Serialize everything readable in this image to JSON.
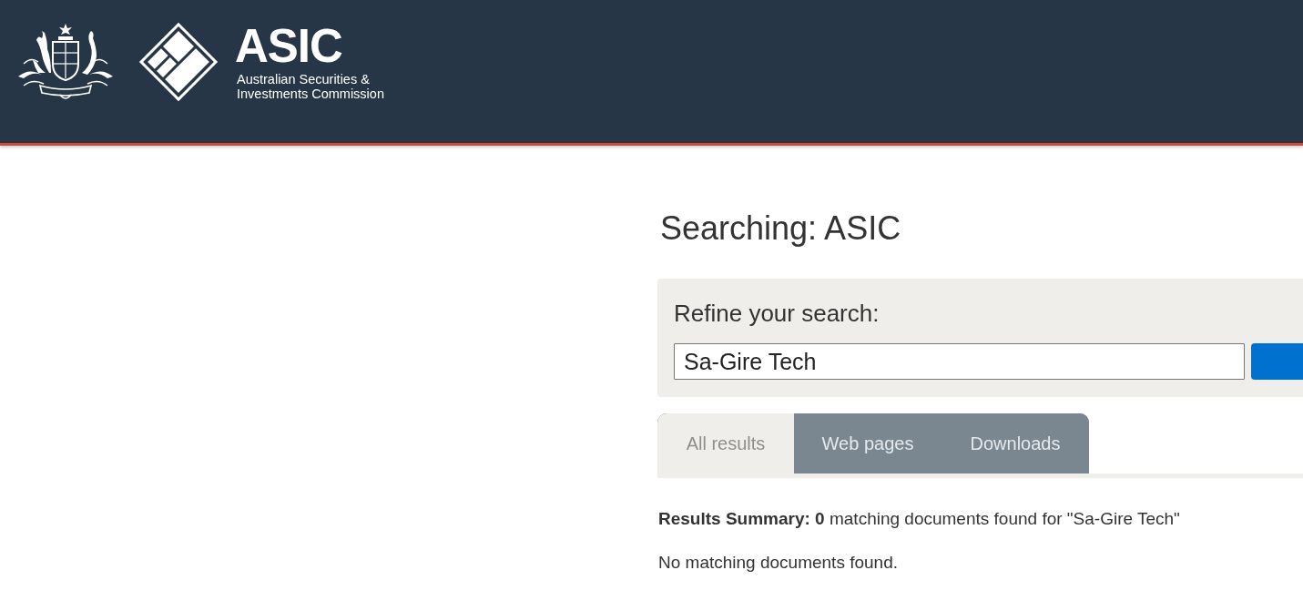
{
  "header": {
    "logo_text": "ASIC",
    "logo_subtitle": [
      "Australian Securities &",
      "Investments Commission"
    ]
  },
  "page": {
    "title": "Searching: ASIC"
  },
  "refine": {
    "label": "Refine your search:",
    "query": "Sa-Gire Tech"
  },
  "tabs": [
    {
      "label": "All results",
      "selected": true
    },
    {
      "label": "Web pages",
      "selected": false
    },
    {
      "label": "Downloads",
      "selected": false
    }
  ],
  "results": {
    "summary": "**Results Summary: 0** matching documents found for \"Sa-Gire Tech\"",
    "message": "No matching documents found."
  }
}
